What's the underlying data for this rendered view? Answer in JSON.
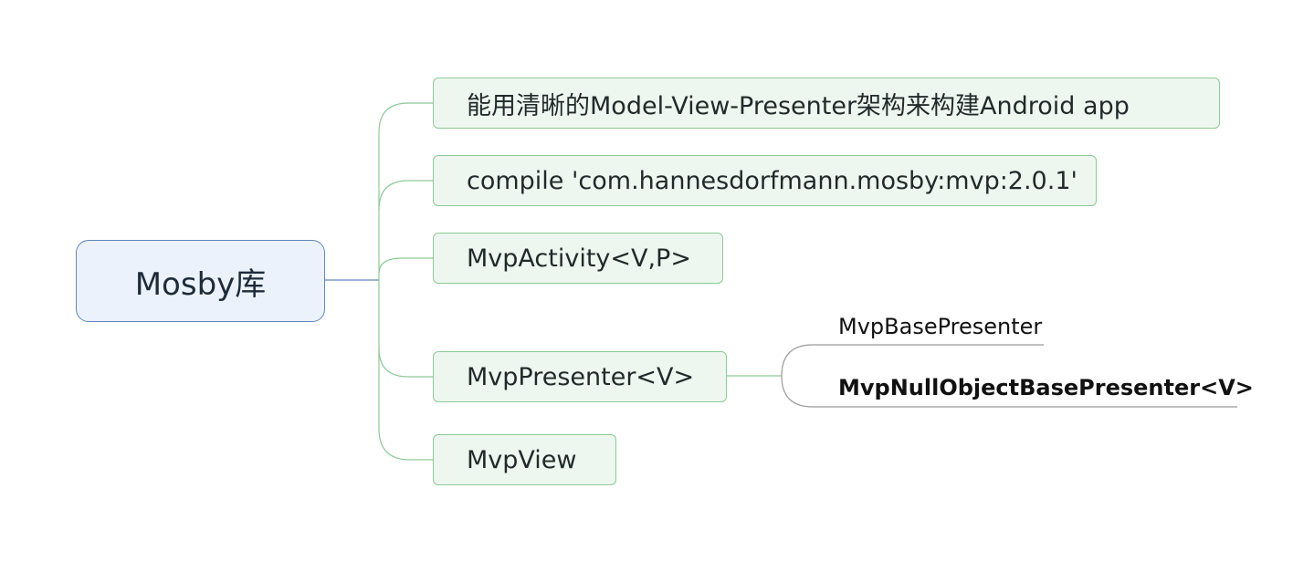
{
  "mindmap": {
    "root": {
      "label": "Mosby库"
    },
    "branches": [
      {
        "label": "能用清晰的Model-View-Presenter架构来构建Android app"
      },
      {
        "label": "compile 'com.hannesdorfmann.mosby:mvp:2.0.1'"
      },
      {
        "label": "MvpActivity<V,P>"
      },
      {
        "label": "MvpPresenter<V>"
      },
      {
        "label": "MvpView"
      }
    ],
    "sub_branches": [
      {
        "label": "MvpBasePresenter"
      },
      {
        "label": "MvpNullObjectBasePresenter<V>"
      }
    ],
    "colors": {
      "root_fill": "#ecf2fb",
      "root_border": "#5f86c2",
      "branch_fill": "#eef6f0",
      "branch_border": "#8ccb95",
      "connector_root": "#5f86c2",
      "connector_branch": "#8ccb95",
      "connector_leaf": "#9a9a9a"
    }
  }
}
